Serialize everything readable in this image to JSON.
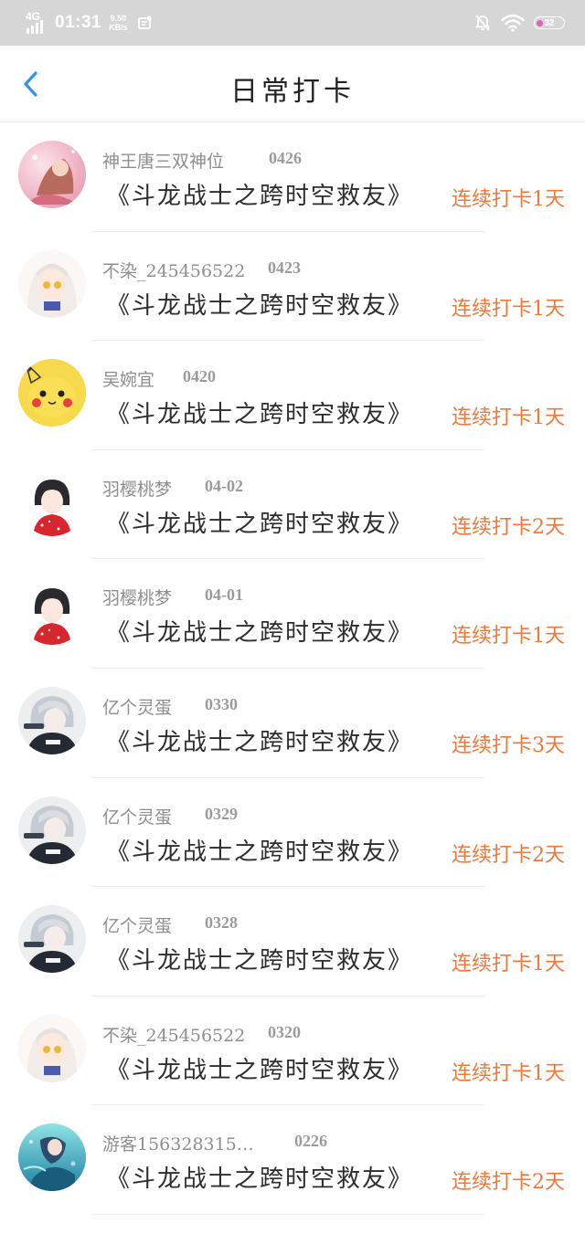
{
  "status_bar": {
    "network": "4G",
    "time": "01:31",
    "speed_value": "9.50",
    "speed_unit": "KB/s",
    "battery": "32",
    "icons": [
      "signal-icon",
      "notification-badge-icon",
      "mute-bell-icon",
      "wifi-icon",
      "battery-icon"
    ]
  },
  "header": {
    "back_icon": "chevron-left-icon",
    "title": "日常打卡"
  },
  "colors": {
    "accent": "#2f93f5",
    "streak": "#f0783a",
    "status_bar_bg": "#d6d6d6"
  },
  "entries": [
    {
      "name": "神王唐三双神位",
      "date": "0426",
      "book": "《斗龙战士之跨时空救友》",
      "streak": "连续打卡1天",
      "avatar": "anime-pink"
    },
    {
      "name": "不染_245456522",
      "date": "0423",
      "book": "《斗龙战士之跨时空救友》",
      "streak": "连续打卡1天",
      "avatar": "anime-white"
    },
    {
      "name": "吴婉宜",
      "date": "0420",
      "book": "《斗龙战士之跨时空救友》",
      "streak": "连续打卡1天",
      "avatar": "pikachu"
    },
    {
      "name": "羽樱桃梦",
      "date": "04-02",
      "book": "《斗龙战士之跨时空救友》",
      "streak": "连续打卡2天",
      "avatar": "anime-red"
    },
    {
      "name": "羽樱桃梦",
      "date": "04-01",
      "book": "《斗龙战士之跨时空救友》",
      "streak": "连续打卡1天",
      "avatar": "anime-red"
    },
    {
      "name": "亿个灵蛋",
      "date": "0330",
      "book": "《斗龙战士之跨时空救友》",
      "streak": "连续打卡3天",
      "avatar": "anime-grey"
    },
    {
      "name": "亿个灵蛋",
      "date": "0329",
      "book": "《斗龙战士之跨时空救友》",
      "streak": "连续打卡2天",
      "avatar": "anime-grey"
    },
    {
      "name": "亿个灵蛋",
      "date": "0328",
      "book": "《斗龙战士之跨时空救友》",
      "streak": "连续打卡1天",
      "avatar": "anime-grey"
    },
    {
      "name": "不染_245456522",
      "date": "0320",
      "book": "《斗龙战士之跨时空救友》",
      "streak": "连续打卡1天",
      "avatar": "anime-white"
    },
    {
      "name": "游客156328315…",
      "date": "0226",
      "book": "《斗龙战士之跨时空救友》",
      "streak": "连续打卡2天",
      "avatar": "anime-ocean"
    }
  ]
}
